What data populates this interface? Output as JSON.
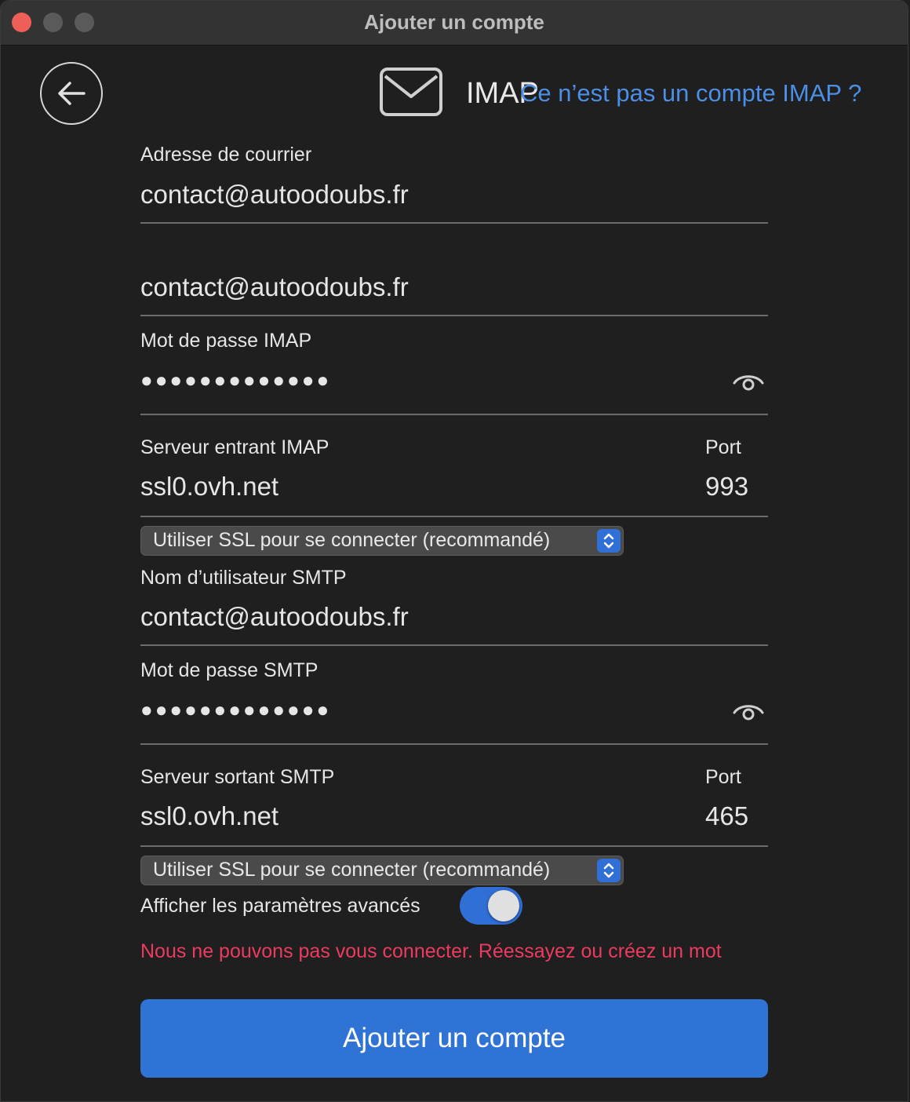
{
  "window": {
    "title": "Ajouter un compte"
  },
  "header": {
    "account_type": "IMAP",
    "not_imap_link": "Ce n’est pas un compte IMAP ?"
  },
  "fields": {
    "email_label": "Adresse de courrier",
    "email_value": "contact@autoodoubs.fr",
    "imap_username_value": "contact@autoodoubs.fr",
    "imap_password_label": "Mot de passe IMAP",
    "imap_password_masked": "●●●●●●●●●●●●●",
    "incoming_server_label": "Serveur entrant IMAP",
    "incoming_server_value": "ssl0.ovh.net",
    "incoming_port_label": "Port",
    "incoming_port_value": "993",
    "incoming_ssl_select": "Utiliser SSL pour se connecter (recommandé)",
    "smtp_username_label": "Nom d’utilisateur SMTP",
    "smtp_username_value": "contact@autoodoubs.fr",
    "smtp_password_label": "Mot de passe SMTP",
    "smtp_password_masked": "●●●●●●●●●●●●●",
    "outgoing_server_label": "Serveur sortant SMTP",
    "outgoing_server_value": "ssl0.ovh.net",
    "outgoing_port_label": "Port",
    "outgoing_port_value": "465",
    "outgoing_ssl_select": "Utiliser SSL pour se connecter (recommandé)",
    "advanced_toggle_label": "Afficher les paramètres avancés",
    "advanced_toggle_on": true
  },
  "error_message": "Nous ne pouvons pas vous connecter. Réessayez ou créez un mot",
  "primary_button": "Ajouter un compte",
  "colors": {
    "accent": "#2f73d4",
    "link": "#4b8fe6",
    "error": "#ec3b5f",
    "background": "#1f1f1f"
  },
  "icons": [
    "back-arrow-icon",
    "mail-icon",
    "eye-icon",
    "chevron-up-down-icon"
  ]
}
